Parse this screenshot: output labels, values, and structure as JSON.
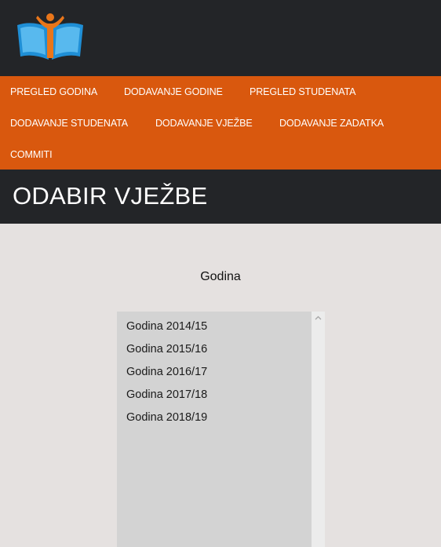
{
  "nav": {
    "items": [
      {
        "label": "PREGLED GODINA"
      },
      {
        "label": "DODAVANJE GODINE"
      },
      {
        "label": "PREGLED STUDENATA"
      },
      {
        "label": "DODAVANJE STUDENATA"
      },
      {
        "label": "DODAVANJE VJEŽBE"
      },
      {
        "label": "DODAVANJE ZADATKA"
      },
      {
        "label": "COMMITI"
      }
    ]
  },
  "page": {
    "title": "ODABIR VJEŽBE"
  },
  "year_select": {
    "label": "Godina",
    "options": [
      "Godina 2014/15",
      "Godina 2015/16",
      "Godina 2016/17",
      "Godina 2017/18",
      "Godina 2018/19"
    ]
  },
  "colors": {
    "header": "#232528",
    "nav": "#d9580e",
    "background": "#e5e1e0"
  },
  "icons": {
    "logo": "open-book-person-logo",
    "scroll_up": "chevron-up-icon"
  }
}
